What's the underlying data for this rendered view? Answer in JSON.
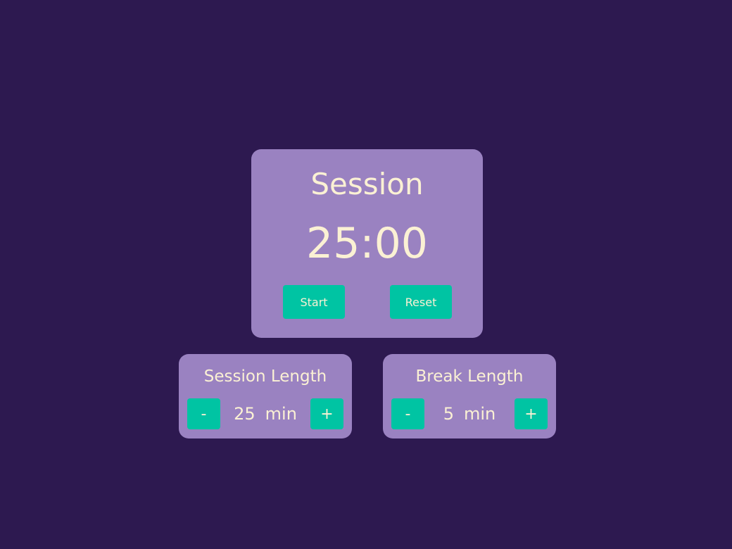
{
  "timer": {
    "label": "Session",
    "time": "25:00",
    "start_label": "Start",
    "reset_label": "Reset"
  },
  "session_length": {
    "title": "Session Length",
    "decrement_label": "-",
    "value": "25",
    "unit": "min",
    "increment_label": "+"
  },
  "break_length": {
    "title": "Break Length",
    "decrement_label": "-",
    "value": "5",
    "unit": "min",
    "increment_label": "+"
  },
  "colors": {
    "background": "#2d1950",
    "card": "#9a82c1",
    "accent": "#00c4a3",
    "text": "#fbf1d4"
  }
}
